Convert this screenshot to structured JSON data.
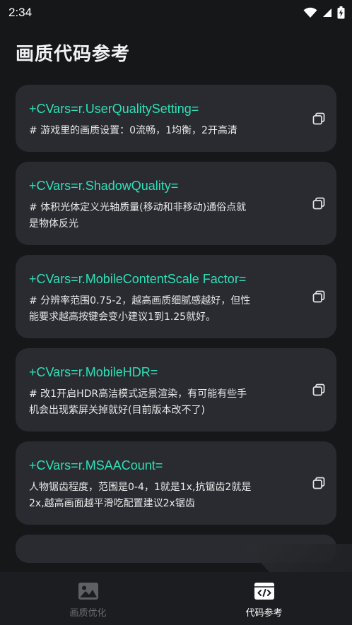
{
  "status_bar": {
    "time": "2:34"
  },
  "page": {
    "title": "画质代码参考"
  },
  "cards": [
    {
      "code": "+CVars=r.UserQualitySetting=",
      "desc_lines": [
        "# 游戏里的画质设置：0流畅，1均衡，2开高清"
      ]
    },
    {
      "code": "+CVars=r.ShadowQuality=",
      "desc_lines": [
        "# 体积光体定义光轴质量(移动和非移动)通俗点就",
        "是物体反光"
      ]
    },
    {
      "code": "+CVars=r.MobileContentScale Factor=",
      "desc_lines": [
        "# 分辨率范围0.75-2，越高画质细腻感越好，但性",
        "能要求越高按键会变小建议1到1.25就好。"
      ]
    },
    {
      "code": "+CVars=r.MobileHDR=",
      "desc_lines": [
        "# 改1开启HDR高洁模式远景渲染，有可能有些手",
        "机会出现紫屏关掉就好(目前版本改不了)"
      ]
    },
    {
      "code": "+CVars=r.MSAACount=",
      "desc_lines": [
        "人物锯齿程度，范围是0-4，1就是1x,抗锯齿2就是",
        "2x,越高画面越平滑吃配置建议2x锯齿"
      ]
    }
  ],
  "nav": {
    "items": [
      {
        "label": "画质优化",
        "icon": "image-icon",
        "active": false
      },
      {
        "label": "代码参考",
        "icon": "code-icon",
        "active": true
      }
    ]
  },
  "colors": {
    "background": "#161719",
    "card": "#2a2b30",
    "code_accent": "#2ce0b8",
    "nav_background": "#1c1d20"
  }
}
